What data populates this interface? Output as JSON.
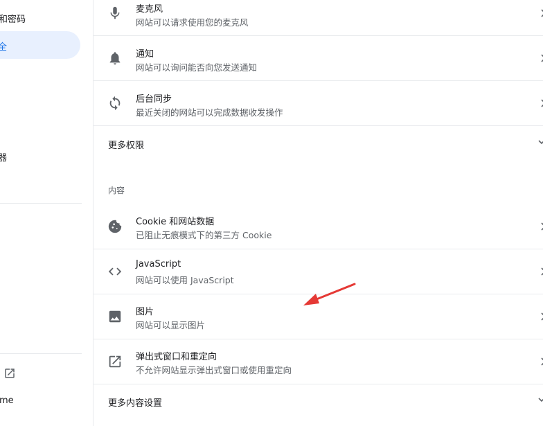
{
  "sidebar": {
    "items": [
      {
        "label": "和密码"
      },
      {
        "label": "全"
      },
      {
        "label": "器"
      },
      {
        "label": "me"
      }
    ]
  },
  "main": {
    "rows_top": [
      {
        "title": "麦克风",
        "subtitle": "网站可以请求使用您的麦克风",
        "icon": "microphone-icon"
      },
      {
        "title": "通知",
        "subtitle": "网站可以询问能否向您发送通知",
        "icon": "bell-icon"
      },
      {
        "title": "后台同步",
        "subtitle": "最近关闭的网站可以完成数据收发操作",
        "icon": "sync-icon"
      }
    ],
    "more_permissions": "更多权限",
    "content_header": "内容",
    "rows_content": [
      {
        "title": "Cookie 和网站数据",
        "subtitle": "已阻止无痕模式下的第三方 Cookie",
        "icon": "cookie-icon"
      },
      {
        "title": "JavaScript",
        "subtitle": "网站可以使用 JavaScript",
        "icon": "code-icon"
      },
      {
        "title": "图片",
        "subtitle": "网站可以显示图片",
        "icon": "image-icon"
      },
      {
        "title": "弹出式窗口和重定向",
        "subtitle": "不允许网站显示弹出式窗口或使用重定向",
        "icon": "popup-icon"
      }
    ],
    "more_content_settings": "更多内容设置"
  },
  "colors": {
    "accent": "#1a73e8",
    "active_bg": "#e8f0fe",
    "annotation": "#e53935"
  }
}
